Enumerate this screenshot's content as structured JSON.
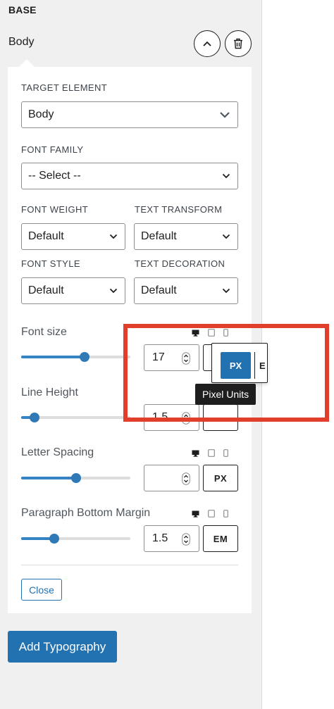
{
  "section": {
    "heading": "BASE"
  },
  "item": {
    "title": "Body"
  },
  "target_element": {
    "label": "TARGET ELEMENT",
    "value": "Body"
  },
  "font_family": {
    "label": "FONT FAMILY",
    "value": "-- Select --"
  },
  "font_weight": {
    "label": "FONT WEIGHT",
    "value": "Default"
  },
  "text_transform": {
    "label": "TEXT TRANSFORM",
    "value": "Default"
  },
  "font_style": {
    "label": "FONT STYLE",
    "value": "Default"
  },
  "text_decoration": {
    "label": "TEXT DECORATION",
    "value": "Default"
  },
  "font_size": {
    "label": "Font size",
    "value": "17",
    "slider_fraction": 0.58
  },
  "line_height": {
    "label": "Line Height",
    "value": "1.5",
    "slider_fraction": 0.12
  },
  "letter_spacing": {
    "label": "Letter Spacing",
    "value": "",
    "unit": "PX",
    "slider_fraction": 0.5
  },
  "paragraph_bottom_margin": {
    "label": "Paragraph Bottom Margin",
    "value": "1.5",
    "unit": "EM",
    "slider_fraction": 0.3
  },
  "unit_popover": {
    "active": "PX",
    "other": "E"
  },
  "tooltip": {
    "text": "Pixel Units"
  },
  "close_label": "Close",
  "add_typography_label": "Add Typography",
  "icons": [
    "chevron-up-icon",
    "trash-icon",
    "chevron-down-icon",
    "desktop-icon",
    "tablet-icon",
    "mobile-icon",
    "spinner-arrows-icon"
  ],
  "colors": {
    "accent": "#2271b1",
    "slider": "#3582c4",
    "highlight": "#e13f2b",
    "tooltip_bg": "#1e1e1e",
    "sidebar_bg": "#f0f0f1"
  }
}
